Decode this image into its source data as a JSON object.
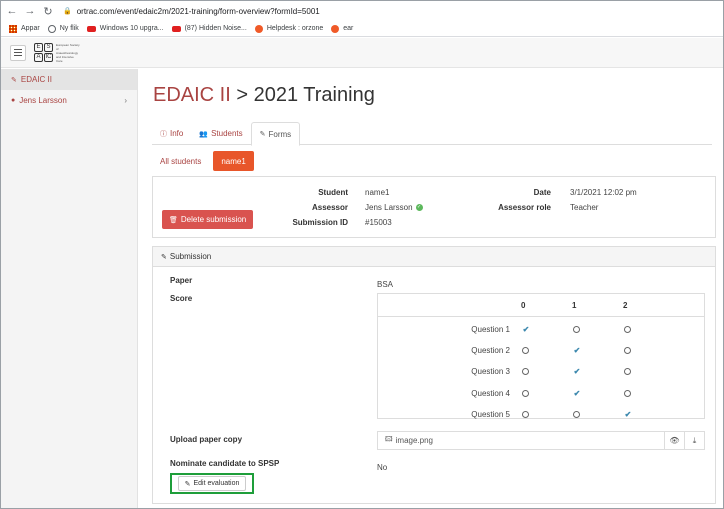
{
  "browser": {
    "url": "ortrac.com/event/edaic2m/2021-training/form-overview?formId=5001",
    "bookmarks": [
      {
        "label": "Appar",
        "icon": "apps-grid-icon"
      },
      {
        "label": "Ny flik",
        "icon": "globe-icon"
      },
      {
        "label": "Windows 10 upgra...",
        "icon": "youtube-icon"
      },
      {
        "label": "(87) Hidden Noise...",
        "icon": "youtube-icon"
      },
      {
        "label": "Helpdesk : orzone",
        "icon": "orzone-icon"
      },
      {
        "label": "ear",
        "icon": "orzone-icon"
      }
    ]
  },
  "app": {
    "logo_letters": [
      "E",
      "S",
      "A",
      "IC"
    ],
    "logo_text": "European Society of Anaesthesiology and Intensive Care"
  },
  "sidebar": {
    "items": [
      {
        "label": "EDAIC II",
        "icon": "edit-icon"
      },
      {
        "label": "Jens Larsson",
        "icon": "user-icon"
      }
    ]
  },
  "page": {
    "breadcrumb": "EDAIC II",
    "separator": ">",
    "title": "2021 Training"
  },
  "tabs": [
    {
      "label": "Info"
    },
    {
      "label": "Students"
    },
    {
      "label": "Forms"
    }
  ],
  "pills": [
    {
      "label": "All students"
    },
    {
      "label": "name1"
    }
  ],
  "submission_info": {
    "delete_label": "Delete submission",
    "student_label": "Student",
    "student_value": "name1",
    "assessor_label": "Assessor",
    "assessor_value": "Jens Larsson",
    "submission_id_label": "Submission ID",
    "submission_id_value": "#15003",
    "date_label": "Date",
    "date_value": "3/1/2021 12:02 pm",
    "assessor_role_label": "Assessor role",
    "assessor_role_value": "Teacher"
  },
  "submission": {
    "header": "Submission",
    "paper_label": "Paper",
    "paper_value": "BSA",
    "score_label": "Score",
    "score_columns": [
      "0",
      "1",
      "2"
    ],
    "questions": [
      {
        "label": "Question 1",
        "selected": 0
      },
      {
        "label": "Question 2",
        "selected": 1
      },
      {
        "label": "Question 3",
        "selected": 1
      },
      {
        "label": "Question 4",
        "selected": 1
      },
      {
        "label": "Question 5",
        "selected": 2
      }
    ],
    "upload_label": "Upload paper copy",
    "upload_file": "image.png",
    "nominate_label": "Nominate candidate to SPSP",
    "nominate_value": "No",
    "edit_label": "Edit evaluation"
  },
  "colors": {
    "accent": "#a94442",
    "active_pill": "#e8562a",
    "danger": "#d9534f",
    "highlight": "#1e9e3a",
    "check": "#3a87ad"
  }
}
